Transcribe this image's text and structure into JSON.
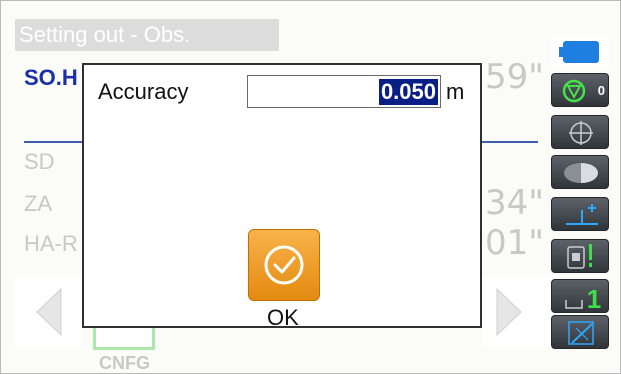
{
  "screen": {
    "title": "Setting out - Obs.",
    "rows": [
      {
        "label": "SO.H",
        "value": "59\""
      },
      {
        "label": "SD",
        "value": ""
      },
      {
        "label": "ZA",
        "value": "34\""
      },
      {
        "label": "HA-R",
        "value": "01\""
      }
    ],
    "softkey": "CNFG"
  },
  "side_panel": {
    "icons": [
      "battery-icon",
      "prism-target-icon",
      "crosshair-icon",
      "laser-pointer-icon",
      "tilt-correction-icon",
      "input-mode-icon",
      "page-number-icon",
      "edit-icon"
    ],
    "target_constant": "0",
    "page_number": "1"
  },
  "dialog": {
    "field_label": "Accuracy",
    "field_value": "0.050",
    "unit": "m",
    "ok_label": "OK"
  },
  "colors": {
    "accent_blue": "#1a2fa8",
    "selection_bg": "#0a1f86",
    "ok_orange": "#f0a030",
    "page_green": "#28d22a"
  }
}
